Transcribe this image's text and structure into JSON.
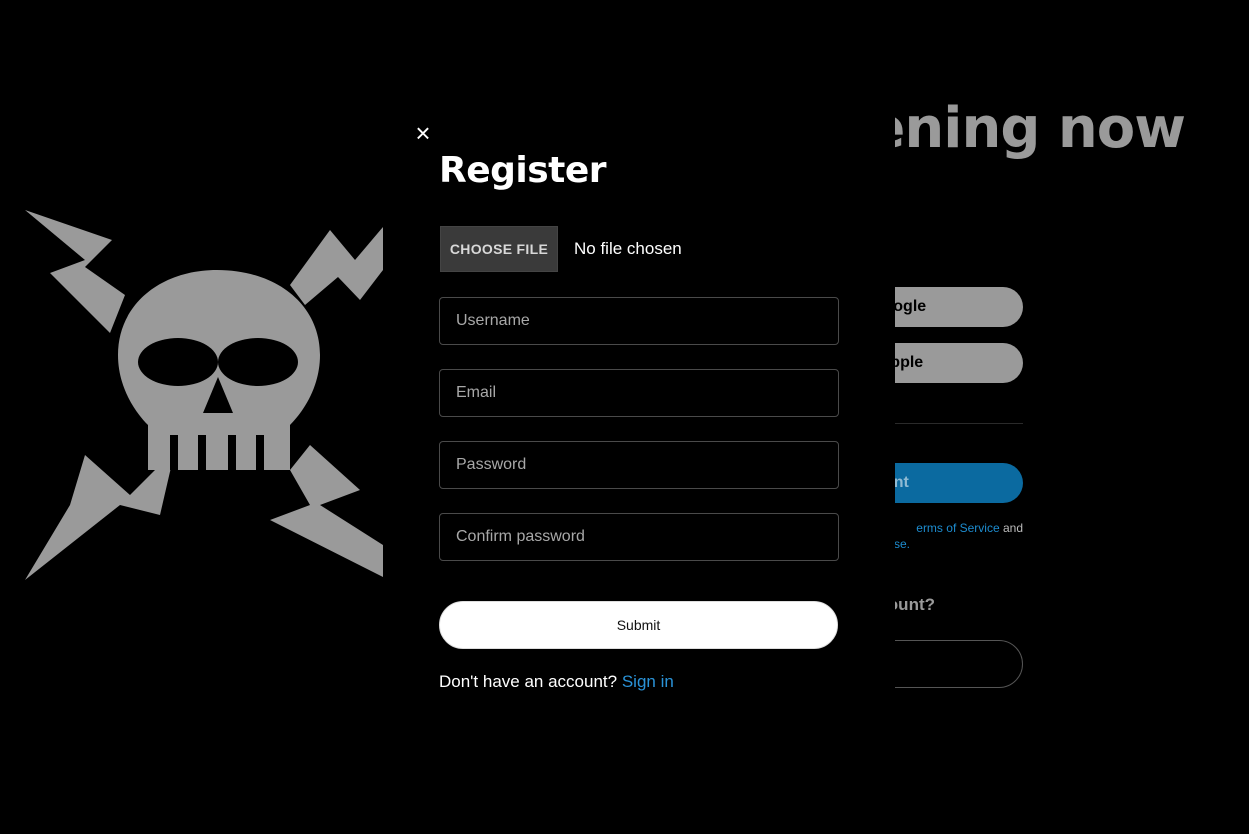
{
  "background": {
    "title": "ening now",
    "google_label": "n Google",
    "apple_label": "th Apple",
    "create_label": "ount",
    "terms_link": "erms of Service",
    "terms_and": "and",
    "terms_line2": "se.",
    "have_account": "ount?",
    "accent": "#0b6aa0"
  },
  "modal": {
    "close_glyph": "×",
    "title": "Register",
    "file_button": "CHOOSE FILE",
    "file_status": "No file chosen",
    "username_placeholder": "Username",
    "email_placeholder": "Email",
    "password_placeholder": "Password",
    "confirm_placeholder": "Confirm password",
    "submit_label": "Submit",
    "switch_text": "Don't have an account?",
    "switch_link": "Sign in",
    "link_color": "#2a93d8"
  },
  "logo": {
    "icon": "skull-lightning-icon",
    "color": "#9a9a9a"
  }
}
